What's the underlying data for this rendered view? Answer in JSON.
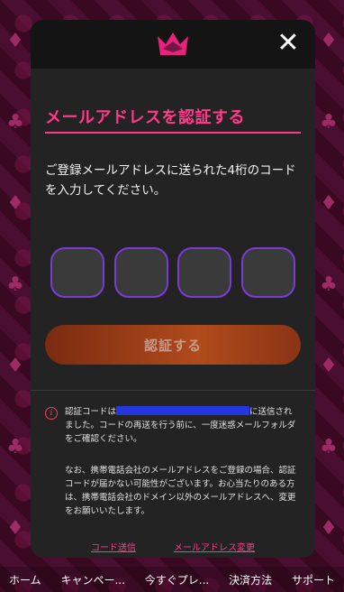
{
  "modal": {
    "title": "メールアドレスを認証する",
    "description": "ご登録メールアドレスに送られた4桁のコードを入力してください。",
    "code_digits": [
      "",
      "",
      "",
      ""
    ],
    "verify_label": "認証する",
    "info_prefix": "認証コードは",
    "info_suffix": "に送信されました。コードの再送を行う前に、一度迷惑メールフォルダをご確認ください。",
    "note": "なお、携帯電話会社のメールアドレスをご登録の場合、認証コードが届かない可能性がございます。お心当たりのある方は、携帯電話会社のドメイン以外のメールアドレスへ、変更をお願いいたします。",
    "resend_label": "コード送信",
    "change_email_label": "メールアドレス変更"
  },
  "bottom_nav": [
    "ホーム",
    "キャンペー...",
    "今すぐプレ...",
    "決済方法",
    "サポート"
  ],
  "colors": {
    "accent": "#ff3a8c",
    "code_border": "#7b3bd8",
    "button": "#b04b1c",
    "modal_bg": "#232323"
  }
}
